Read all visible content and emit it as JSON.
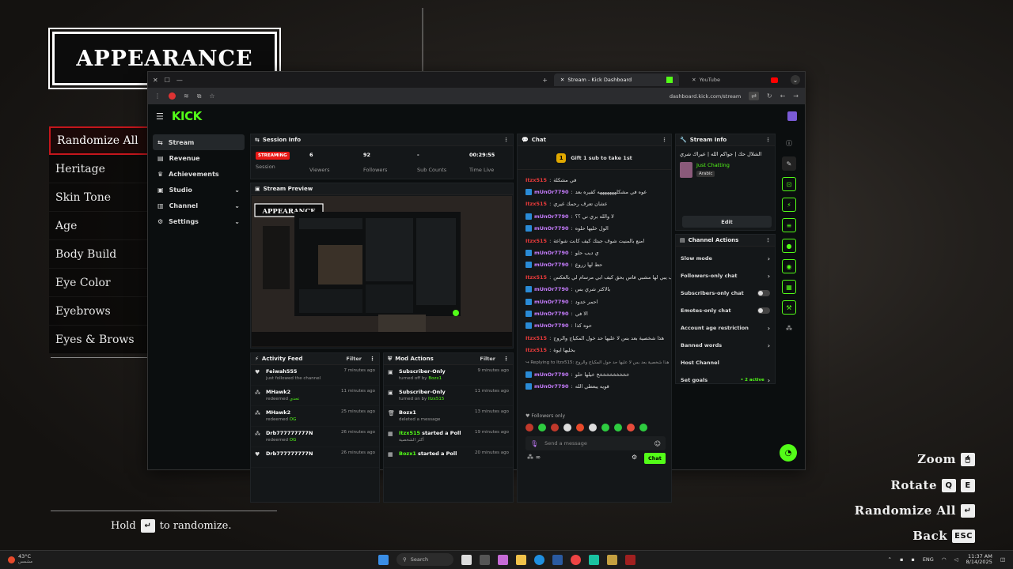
{
  "game": {
    "title": "APPEARANCE",
    "menu": [
      "Randomize All",
      "Heritage",
      "Skin Tone",
      "Age",
      "Body Build",
      "Eye Color",
      "Eyebrows",
      "Eyes & Brows"
    ],
    "hint_hold": "Hold",
    "hint_rest": "to randomize.",
    "controls": [
      {
        "label": "Zoom",
        "key": "🖱"
      },
      {
        "label": "Rotate",
        "key": "Q",
        "key2": "E"
      },
      {
        "label": "Randomize All",
        "key": "↵"
      },
      {
        "label": "Back",
        "key": "ESC"
      }
    ]
  },
  "browser": {
    "tabs": [
      {
        "label": "Stream - Kick Dashboard"
      },
      {
        "label": "YouTube"
      }
    ],
    "url": "dashboard.kick.com/stream"
  },
  "kick": {
    "logo": "KICK",
    "sidebar": [
      {
        "label": "Stream",
        "icon": "stream-icon",
        "active": true
      },
      {
        "label": "Revenue",
        "icon": "revenue-icon"
      },
      {
        "label": "Achievements",
        "icon": "trophy-icon"
      },
      {
        "label": "Studio",
        "icon": "studio-icon",
        "chevron": true
      },
      {
        "label": "Channel",
        "icon": "channel-icon",
        "chevron": true
      },
      {
        "label": "Settings",
        "icon": "gear-icon",
        "chevron": true
      }
    ],
    "session": {
      "title": "Session Info",
      "status": "STREAMING",
      "status_label": "Session",
      "stats": [
        {
          "value": "6",
          "label": "Viewers"
        },
        {
          "value": "92",
          "label": "Followers"
        },
        {
          "value": "-",
          "label": "Sub Counts"
        },
        {
          "value": "00:29:55",
          "label": "Time Live"
        }
      ]
    },
    "preview_title": "Stream Preview",
    "activity": {
      "title": "Activity Feed",
      "filter": "Filter",
      "rows": [
        {
          "user": "Feiwah555",
          "sub": "just followed the channel",
          "time": "7 minutes ago",
          "icon": "heart-icon"
        },
        {
          "user": "MHawk2",
          "sub": "redeemed",
          "extra": "تحدي",
          "time": "11 minutes ago",
          "icon": "redeem-icon"
        },
        {
          "user": "MHawk2",
          "sub": "redeemed",
          "extra": "OG",
          "time": "25 minutes ago",
          "icon": "redeem-icon"
        },
        {
          "user": "Drb777777777N",
          "sub": "redeemed",
          "extra": "OG",
          "time": "26 minutes ago",
          "icon": "redeem-icon"
        },
        {
          "user": "Drb777777777N",
          "sub": "",
          "time": "26 minutes ago",
          "icon": "heart-icon"
        }
      ]
    },
    "mod": {
      "title": "Mod Actions",
      "filter": "Filter",
      "rows": [
        {
          "user": "Subscriber-Only",
          "sub": "turned off by",
          "extra": "Bozx1",
          "time": "9 minutes ago",
          "icon": "gift-icon"
        },
        {
          "user": "Subscriber-Only",
          "sub": "turned on by",
          "extra": "Itzx515",
          "time": "11 minutes ago",
          "icon": "gift-icon"
        },
        {
          "user": "Bozx1",
          "sub": "deleted a message",
          "time": "13 minutes ago",
          "icon": "trash-icon"
        },
        {
          "user": "Itzx515",
          "tail": "started a Poll",
          "sub": "أكثر الشخصية",
          "time": "19 minutes ago",
          "icon": "poll-icon"
        },
        {
          "user": "Bozx1",
          "tail": "started a Poll",
          "sub": "",
          "time": "20 minutes ago",
          "icon": "poll-icon"
        }
      ]
    },
    "chat": {
      "title": "Chat",
      "gift": "Gift 1 sub to take 1st",
      "gift_count": "1",
      "messages": [
        {
          "user": "Itzx515",
          "color": "#e83a3a",
          "text": "في مشكلة"
        },
        {
          "user": "mUnOr7790",
          "color": "#c77dff",
          "text": "عوه في مشكلهههههههه كفيره بعد"
        },
        {
          "user": "Itzx515",
          "color": "#e83a3a",
          "text": "عشان تعرف رحمك غيري"
        },
        {
          "user": "mUnOr7790",
          "color": "#c77dff",
          "text": "لا والله بري ني ؟؟"
        },
        {
          "user": "mUnOr7790",
          "color": "#c77dff",
          "text": "الول خليها حلوه"
        },
        {
          "user": "Itzx515",
          "color": "#e83a3a",
          "text": "امنع بالمنيت شوف جبتك كيف كانت شواعة"
        },
        {
          "user": "mUnOr7790",
          "color": "#c77dff",
          "text": "ي ديب حلو"
        },
        {
          "user": "mUnOr7790",
          "color": "#c77dff",
          "text": "حط لها زروع"
        },
        {
          "user": "Itzx515",
          "color": "#e83a3a",
          "text": "جده كيف يبي لها مشبي فاس بحق كيف ابي مرسام لي بالعكس"
        },
        {
          "user": "mUnOr7790",
          "color": "#c77dff",
          "text": "بالاكثر شري بس"
        },
        {
          "user": "mUnOr7790",
          "color": "#c77dff",
          "text": "احمر خدود"
        },
        {
          "user": "mUnOr7790",
          "color": "#c77dff",
          "text": "الا في"
        },
        {
          "user": "mUnOr7790",
          "color": "#c77dff",
          "text": "حوه كذا"
        },
        {
          "user": "Itzx515",
          "color": "#e83a3a",
          "text": "هذا شخصية بعد بس لا عليها حد خول المكياج والروج"
        },
        {
          "user": "Itzx515",
          "color": "#e83a3a",
          "text": "بخليها ايوة"
        },
        {
          "user": "",
          "color": "#999",
          "text": "↪ Replying to Itzx515: هذا شخصية بعد بس لا عليها حد خول المكياج والروج"
        },
        {
          "user": "mUnOr7790",
          "color": "#c77dff",
          "text": "خخخخخخخخخخ خيلها حلو"
        },
        {
          "user": "mUnOr7790",
          "color": "#c77dff",
          "text": "قويه يبعطي الله"
        }
      ],
      "followers_only": "Followers only",
      "placeholder": "Send a message",
      "send": "Chat"
    },
    "stream_info": {
      "title": "Stream Info",
      "stream_title": "الشلال حك | جواكم الله | عيراك شري",
      "category": "Just Chatting",
      "language": "Arabic",
      "edit": "Edit"
    },
    "channel_actions": {
      "title": "Channel Actions",
      "rows": [
        {
          "label": "Slow mode",
          "kind": "chevron"
        },
        {
          "label": "Followers-only chat",
          "kind": "chevron"
        },
        {
          "label": "Subscribers-only chat",
          "kind": "toggle"
        },
        {
          "label": "Emotes-only chat",
          "kind": "toggle"
        },
        {
          "label": "Account age restriction",
          "kind": "chevron"
        },
        {
          "label": "Banned words",
          "kind": "chevron"
        },
        {
          "label": "Host Channel",
          "kind": "none"
        },
        {
          "label": "Set goals",
          "kind": "chevron",
          "extra": "• 2 active"
        }
      ]
    },
    "colors": {
      "accent": "#53fc18",
      "live": "#e91916"
    }
  },
  "taskbar": {
    "weather": "43°C",
    "weather_sub": "مشمس",
    "search": "Search",
    "lang": "ENG",
    "time": "11:37 AM",
    "date": "8/14/2025"
  }
}
